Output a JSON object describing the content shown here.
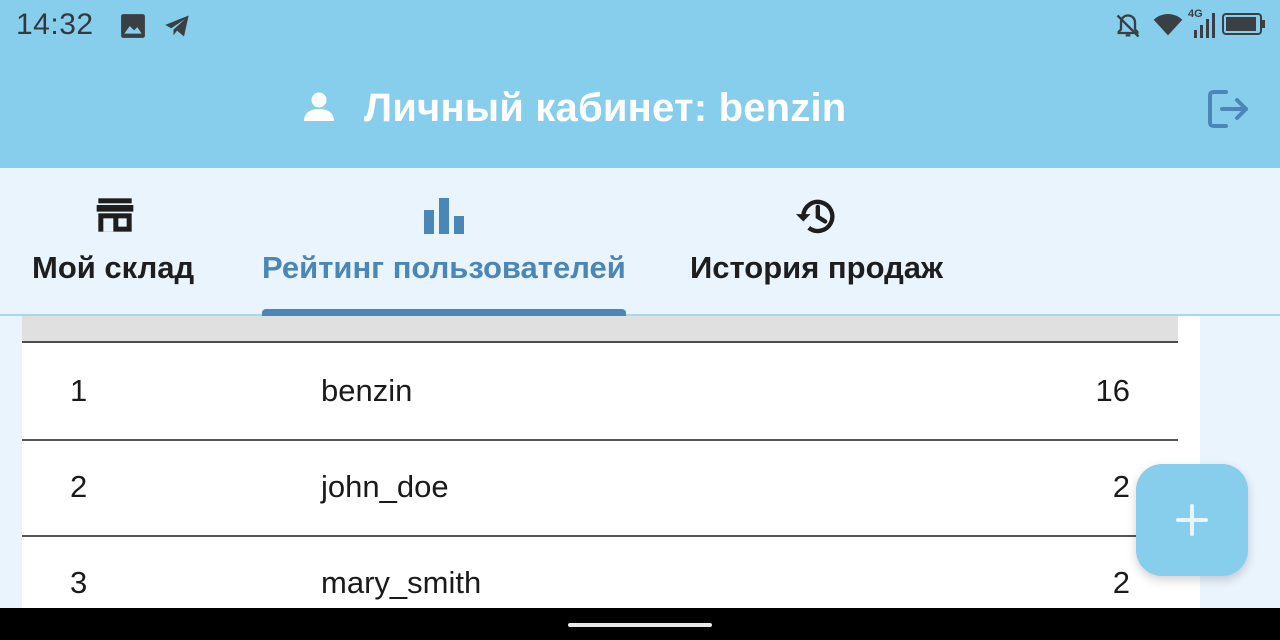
{
  "status_bar": {
    "time": "14:32",
    "icons": [
      "image-icon",
      "telegram-icon",
      "bell-off-icon",
      "wifi-icon",
      "signal-4g-icon",
      "battery-icon"
    ],
    "network_label": "4G"
  },
  "app_bar": {
    "title": "Личный кабинет: benzin",
    "icons": [
      "person-icon",
      "logout-icon"
    ]
  },
  "tabs": [
    {
      "label": "Мой склад",
      "icon": "store-icon",
      "active": false
    },
    {
      "label": "Рейтинг пользователей",
      "icon": "bar-chart-icon",
      "active": true
    },
    {
      "label": "История продаж",
      "icon": "history-icon",
      "active": false
    }
  ],
  "rating_table": {
    "rows": [
      {
        "rank": "1",
        "name": "benzin",
        "score": "16"
      },
      {
        "rank": "2",
        "name": "john_doe",
        "score": "2"
      },
      {
        "rank": "3",
        "name": "mary_smith",
        "score": "2"
      }
    ]
  },
  "fab": {
    "icon": "plus-icon"
  },
  "colors": {
    "primary": "#87ceed",
    "accent": "#4a86b6",
    "background": "#eaf4fd"
  }
}
